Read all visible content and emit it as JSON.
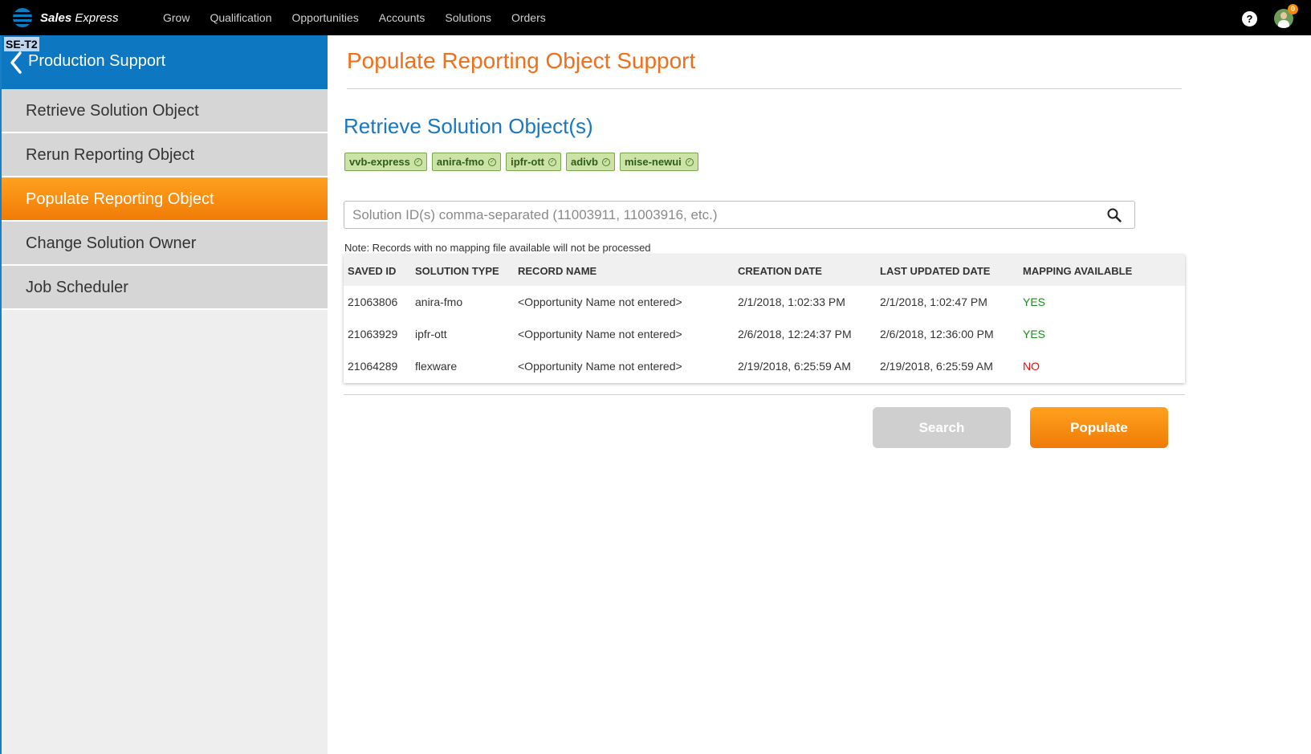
{
  "topbar": {
    "brand_bold": "Sales",
    "brand_italic": "Express",
    "nav": [
      "Grow",
      "Qualification",
      "Opportunities",
      "Accounts",
      "Solutions",
      "Orders"
    ],
    "help_label": "?",
    "notification_count": "0"
  },
  "sidebar": {
    "env_tag": "SE-T2",
    "title": "Production Support",
    "items": [
      {
        "label": "Retrieve Solution Object",
        "active": false
      },
      {
        "label": "Rerun Reporting Object",
        "active": false
      },
      {
        "label": "Populate Reporting Object",
        "active": true
      },
      {
        "label": "Change Solution Owner",
        "active": false
      },
      {
        "label": "Job Scheduler",
        "active": false
      }
    ]
  },
  "main": {
    "page_title": "Populate Reporting Object Support",
    "section_title": "Retrieve Solution Object(s)",
    "tags": [
      "vvb-express",
      "anira-fmo",
      "ipfr-ott",
      "adivb",
      "mise-newui"
    ],
    "search_placeholder": "Solution ID(s) comma-separated (11003911, 11003916, etc.)",
    "note": "Note: Records with no mapping file available will not be processed",
    "table": {
      "headers": [
        "SAVED ID",
        "SOLUTION TYPE",
        "RECORD NAME",
        "CREATION DATE",
        "LAST UPDATED DATE",
        "MAPPING AVAILABLE"
      ],
      "rows": [
        [
          "21063806",
          "anira-fmo",
          "<Opportunity Name not entered>",
          "2/1/2018, 1:02:33 PM",
          "2/1/2018, 1:02:47 PM",
          "YES"
        ],
        [
          "21063929",
          "ipfr-ott",
          "<Opportunity Name not entered>",
          "2/6/2018, 12:24:37 PM",
          "2/6/2018, 12:36:00 PM",
          "YES"
        ],
        [
          "21064289",
          "flexware",
          "<Opportunity Name not entered>",
          "2/19/2018, 6:25:59 AM",
          "2/19/2018, 6:25:59 AM",
          "NO"
        ]
      ]
    },
    "buttons": {
      "search": "Search",
      "populate": "Populate"
    }
  },
  "colors": {
    "accent_orange": "#f07b07",
    "header_blue": "#0d77c1",
    "title_orange": "#ef6f1a",
    "section_blue": "#1878c0",
    "yes_green": "#198c19",
    "no_red": "#e01010"
  }
}
